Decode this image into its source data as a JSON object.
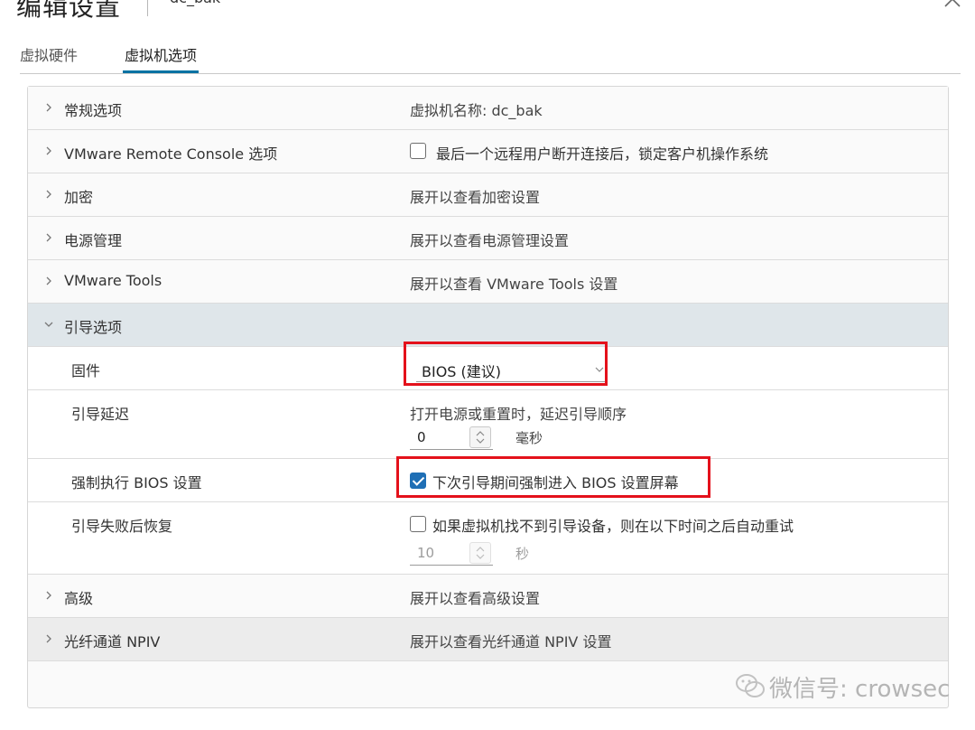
{
  "window": {
    "title": "编辑设置",
    "vm_name": "dc_bak"
  },
  "tabs": [
    {
      "label": "虚拟硬件",
      "active": false
    },
    {
      "label": "虚拟机选项",
      "active": true
    }
  ],
  "sections": {
    "general": {
      "label": "常规选项",
      "value": "虚拟机名称: dc_bak"
    },
    "vmrc": {
      "label": "VMware Remote Console 选项",
      "checkbox_label": "最后一个远程用户断开连接后，锁定客户机操作系统",
      "checked": false
    },
    "encryption": {
      "label": "加密",
      "value": "展开以查看加密设置"
    },
    "power": {
      "label": "电源管理",
      "value": "展开以查看电源管理设置"
    },
    "tools": {
      "label": "VMware Tools",
      "value": "展开以查看 VMware Tools 设置"
    },
    "boot": {
      "label": "引导选项",
      "firmware": {
        "label": "固件",
        "selected": "BIOS (建议)"
      },
      "boot_delay": {
        "label": "引导延迟",
        "description": "打开电源或重置时，延迟引导顺序",
        "value": "0",
        "unit": "毫秒"
      },
      "force_bios": {
        "label": "强制执行 BIOS 设置",
        "checkbox_label": "下次引导期间强制进入 BIOS 设置屏幕",
        "checked": true
      },
      "failed_boot": {
        "label": "引导失败后恢复",
        "checkbox_label": "如果虚拟机找不到引导设备，则在以下时间之后自动重试",
        "checked": false,
        "value": "10",
        "unit": "秒"
      }
    },
    "advanced": {
      "label": "高级",
      "value": "展开以查看高级设置"
    },
    "npiv": {
      "label": "光纤通道 NPIV",
      "value": "展开以查看光纤通道 NPIV 设置"
    }
  },
  "watermark": {
    "text": "微信号: crowsec"
  },
  "colors": {
    "accent": "#0072a3",
    "highlight": "#e4111b",
    "checkbox": "#1f6fb5",
    "expanded_row": "#dfe6ea"
  }
}
